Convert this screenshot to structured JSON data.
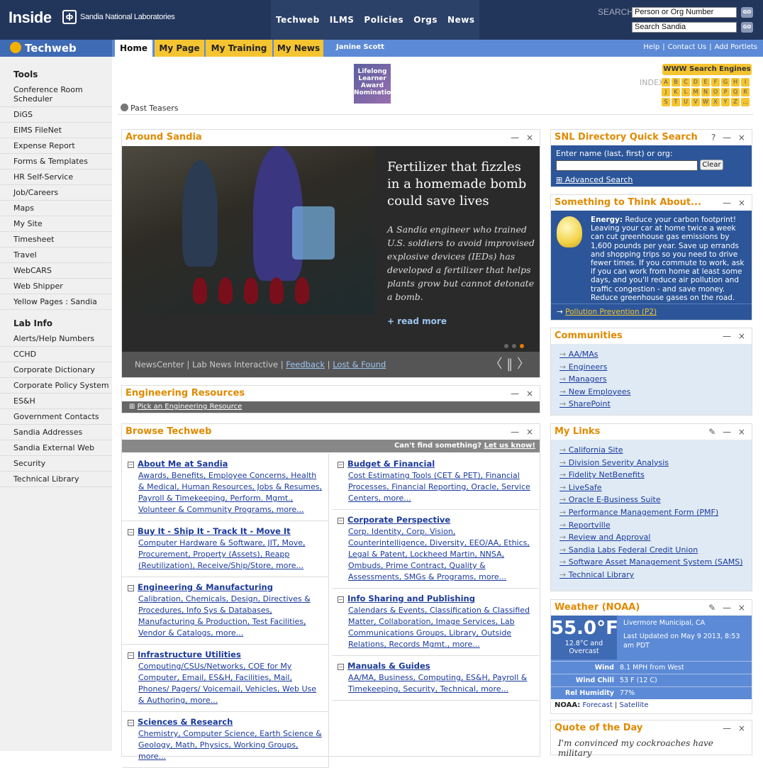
{
  "top": {
    "logo": "Inside",
    "org": "Sandia National Laboratories",
    "nav": [
      "Techweb",
      "ILMS",
      "Policies",
      "Orgs",
      "News"
    ],
    "search_label": "SEARCH",
    "search1_value": "Person or Org Number",
    "search2_value": "Search Sandia",
    "go": "GO"
  },
  "bar2": {
    "logo": "Techweb",
    "tabs": [
      "Home",
      "My Page",
      "My Training",
      "My News"
    ],
    "user": "Janine Scott",
    "right_links": [
      "Help",
      "Contact Us",
      "Add Portlets"
    ]
  },
  "sidebar": {
    "tools_heading": "Tools",
    "tools": [
      "Conference Room Scheduler",
      "DiGS",
      "EIMS FileNet",
      "Expense Report",
      "Forms & Templates",
      "HR Self-Service",
      "Job/Careers",
      "Maps",
      "My Site",
      "Timesheet",
      "Travel",
      "WebCARS",
      "Web Shipper",
      "Yellow Pages : Sandia"
    ],
    "lab_heading": "Lab Info",
    "lab": [
      "Alerts/Help Numbers",
      "CCHD",
      "Corporate Dictionary",
      "Corporate Policy System",
      "ES&H",
      "Government Contacts",
      "Sandia Addresses",
      "Sandia External Web",
      "Security",
      "Technical Library"
    ]
  },
  "teaser": {
    "past": "Past Teasers",
    "award": "Lifelong Learner Award Nominations",
    "wse": "WWW Search Engines",
    "index_label": "INDEX",
    "letters": [
      "A",
      "B",
      "C",
      "D",
      "E",
      "F",
      "G",
      "H",
      "I",
      "J",
      "K",
      "L",
      "M",
      "N",
      "O",
      "P",
      "Q",
      "R",
      "S",
      "T",
      "U",
      "V",
      "W",
      "X",
      "Y",
      "Z",
      "..."
    ]
  },
  "around": {
    "title": "Around Sandia",
    "headline": "Fertilizer that fizzles in a homemade bomb could save lives",
    "summary": "A Sandia engineer who trained U.S. soldiers to avoid improvised explosive devices (IEDs) has developed a fertilizer that helps plants grow but cannot detonate a bomb.",
    "read_more": "+ read more",
    "footer_links": [
      "NewsCenter",
      "Lab News Interactive",
      "Feedback",
      "Lost & Found"
    ],
    "nav": "〈  ‖  〉"
  },
  "eng": {
    "title": "Engineering Resources",
    "pick": "Pick an Engineering Resource"
  },
  "browse": {
    "title": "Browse Techweb",
    "cant_find": "Can't find something?",
    "let_us_know": "Let us know!",
    "left": [
      {
        "title": "About Me at Sandia",
        "body": "Awards, Benefits, Employee Concerns, Health & Medical, Human Resources, Jobs & Resumes, Payroll & Timekeeping, Perform. Mgmt., Volunteer & Community Programs, more..."
      },
      {
        "title": "Buy It - Ship It - Track It - Move It",
        "body": "Computer Hardware & Software, JIT, Move, Procurement, Property (Assets), Reapp (Reutilization), Receive/Ship/Store, more..."
      },
      {
        "title": "Engineering & Manufacturing",
        "body": "Calibration, Chemicals, Design, Directives & Procedures, Info Sys & Databases, Manufacturing & Production, Test Facilities, Vendor & Catalogs, more..."
      },
      {
        "title": "Infrastructure Utilities",
        "body": "Computing/CSUs/Networks, COE for My Computer, Email, ES&H, Facilities, Mail, Phones/ Pagers/ Voicemail, Vehicles, Web Use & Authoring, more..."
      },
      {
        "title": "Sciences & Research",
        "body": "Chemistry, Computer Science, Earth Science & Geology, Math, Physics, Working Groups, more..."
      }
    ],
    "right": [
      {
        "title": "Budget & Financial",
        "body": "Cost Estimating Tools (CET & PET), Financial Processes, Financial Reporting, Oracle, Service Centers, more..."
      },
      {
        "title": "Corporate Perspective",
        "body": "Corp. Identity, Corp. Vision, Counterintelligence, Diversity, EEO/AA, Ethics, Legal & Patent, Lockheed Martin, NNSA, Ombuds, Prime Contract, Quality & Assessments, SMGs & Programs, more..."
      },
      {
        "title": "Info Sharing and Publishing",
        "body": "Calendars & Events, Classification & Classified Matter, Collaboration, Image Services, Lab Communications Groups, Library, Outside Relations, Records Mgmt., more..."
      },
      {
        "title": "Manuals & Guides",
        "body": "AA/MA, Business, Computing, ES&H, Payroll & Timekeeping, Security, Technical, more..."
      }
    ]
  },
  "dir": {
    "title": "SNL Directory Quick Search",
    "ctl": "? — ×",
    "prompt": "Enter name (last, first) or org:",
    "clear": "Clear",
    "advanced": "Advanced Search"
  },
  "think": {
    "title": "Something to Think About...",
    "lead": "Energy:",
    "text": "Reduce your carbon footprint! Leaving your car at home twice a week can cut greenhouse gas emissions by 1,600 pounds per year. Save up errands and shopping trips so you need to drive fewer times. If you commute to work, ask if you can work from home at least some days, and you'll reduce air pollution and traffic congestion - and save money. Reduce greenhouse gases on the road.",
    "link": "Pollution Prevention (P2)"
  },
  "comm": {
    "title": "Communities",
    "items": [
      "AA/MAs",
      "Engineers",
      "Managers",
      "New Employees",
      "SharePoint"
    ]
  },
  "mylinks": {
    "title": "My Links",
    "items": [
      "California Site",
      "Division Severity Analysis",
      "Fidelity NetBenefits",
      "LiveSafe",
      "Oracle E-Business Suite",
      "Performance Management Form (PMF)",
      "Reportville",
      "Review and Approval",
      "Sandia Labs Federal Credit Union",
      "Software Asset Management System (SAMS)",
      "Technical Library"
    ]
  },
  "weather": {
    "title": "Weather (NOAA)",
    "temp_f": "55.0°F",
    "temp_c": "12.8°C and",
    "cond": "Overcast",
    "location": "Livermore Municipal, CA",
    "updated": "Last Updated on May 9 2013, 8:53 am PDT",
    "rows": [
      {
        "k": "Wind",
        "v": "8.1 MPH from West"
      },
      {
        "k": "Wind Chill",
        "v": "53 F (12 C)"
      },
      {
        "k": "Rel Humidity",
        "v": "77%"
      }
    ],
    "noaa": "NOAA:",
    "forecast": "Forecast",
    "satellite": "Satellite"
  },
  "quote": {
    "title": "Quote of the Day",
    "text": "I'm convinced my cockroaches have military"
  },
  "colors": {
    "navy": "#22365c",
    "blue": "#5c8ad6",
    "gold": "#f5c431",
    "orange": "#e08a00"
  }
}
